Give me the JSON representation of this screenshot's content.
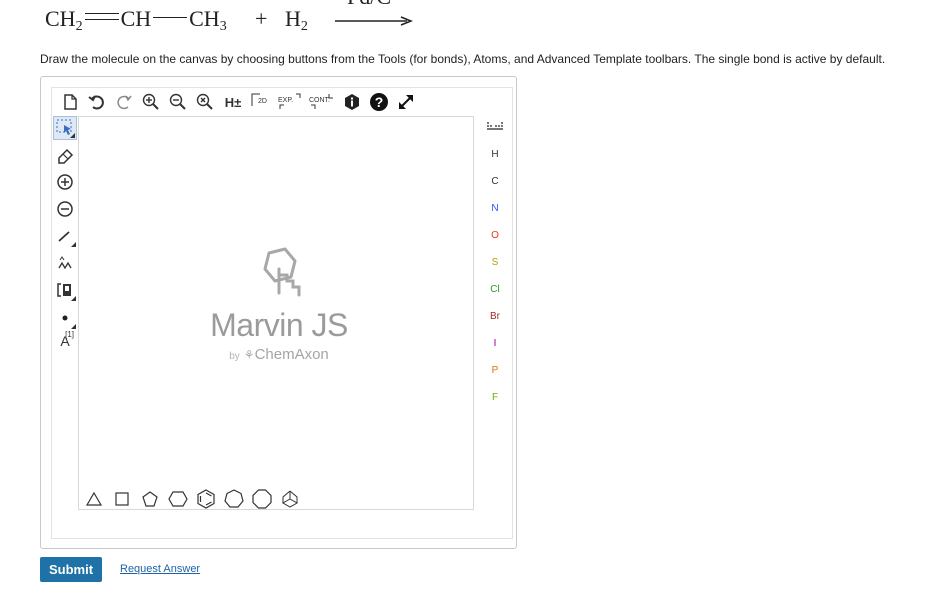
{
  "reaction": {
    "reactant1_parts": [
      "CH",
      "2",
      "CH",
      "CH",
      "3"
    ],
    "plus": "+",
    "reactant2": "H",
    "reactant2_sub": "2",
    "catalyst": "Pd/C"
  },
  "instructions": "Draw the molecule on the canvas by choosing buttons from the Tools (for bonds), Atoms, and Advanced Template toolbars. The single bond is active by default.",
  "editor": {
    "top_toolbar": {
      "h_label": "H±",
      "clean2d_label": "2D",
      "expand_label": "EXP.",
      "contract_label": "CONT."
    },
    "left_toolbar": {
      "charge_label": "A",
      "map_label": "[1]"
    },
    "watermark": {
      "title": "Marvin JS",
      "by": "by",
      "company": "ChemAxon"
    },
    "atoms": [
      {
        "symbol": "H",
        "color": "#333333"
      },
      {
        "symbol": "C",
        "color": "#333333"
      },
      {
        "symbol": "N",
        "color": "#3050F8"
      },
      {
        "symbol": "O",
        "color": "#E8341C"
      },
      {
        "symbol": "S",
        "color": "#B8A000"
      },
      {
        "symbol": "Cl",
        "color": "#1FA01F"
      },
      {
        "symbol": "Br",
        "color": "#A62929"
      },
      {
        "symbol": "I",
        "color": "#940094"
      },
      {
        "symbol": "P",
        "color": "#E07000"
      },
      {
        "symbol": "F",
        "color": "#6FB000"
      }
    ]
  },
  "actions": {
    "submit": "Submit",
    "request_answer": "Request Answer"
  }
}
